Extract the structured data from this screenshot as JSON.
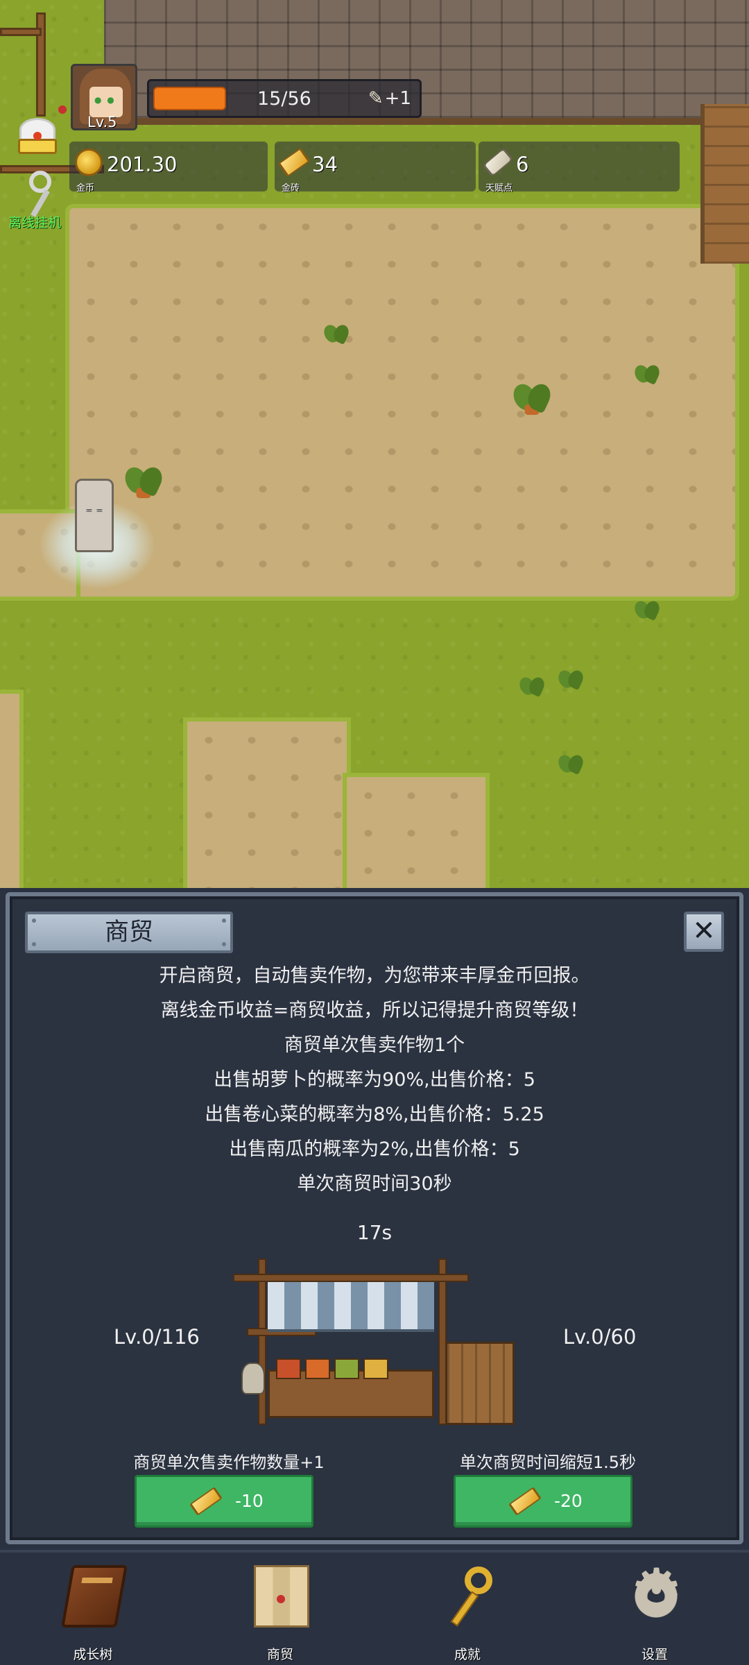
{
  "hud": {
    "level": "Lv.5",
    "xp_text": "15/56",
    "xp_progress": 0.27,
    "xp_bonus": "+1",
    "resources": [
      {
        "icon": "coin-icon",
        "value": "201.30",
        "label": "金币"
      },
      {
        "icon": "gold-bar-icon",
        "value": "34",
        "label": "金砖"
      },
      {
        "icon": "scroll-icon",
        "value": "6",
        "label": "天赋点"
      }
    ],
    "idle_label": "离线挂机"
  },
  "panel": {
    "title": "商贸",
    "close_symbol": "✕",
    "description": [
      "开启商贸，自动售卖作物，为您带来丰厚金币回报。",
      "离线金币收益=商贸收益，所以记得提升商贸等级！",
      "商贸单次售卖作物1个",
      "出售胡萝卜的概率为90%,出售价格：5",
      "出售卷心菜的概率为8%,出售价格：5.25",
      "出售南瓜的概率为2%,出售价格：5",
      "单次商贸时间30秒"
    ],
    "timer": "17s",
    "upgrades": [
      {
        "level": "Lv.0/116",
        "desc": "商贸单次售卖作物数量+1",
        "cost": "-10"
      },
      {
        "level": "Lv.0/60",
        "desc": "单次商贸时间缩短1.5秒",
        "cost": "-20"
      }
    ]
  },
  "nav": [
    {
      "icon": "book-icon",
      "label": "成长树"
    },
    {
      "icon": "map-icon",
      "label": "商贸"
    },
    {
      "icon": "key-icon",
      "label": "成就"
    },
    {
      "icon": "gear-icon",
      "label": "设置"
    }
  ],
  "colors": {
    "accent_orange": "#f07a1a",
    "button_green": "#3fb664",
    "panel_bg": "#2b3240",
    "idle_green": "#5ef05e"
  }
}
